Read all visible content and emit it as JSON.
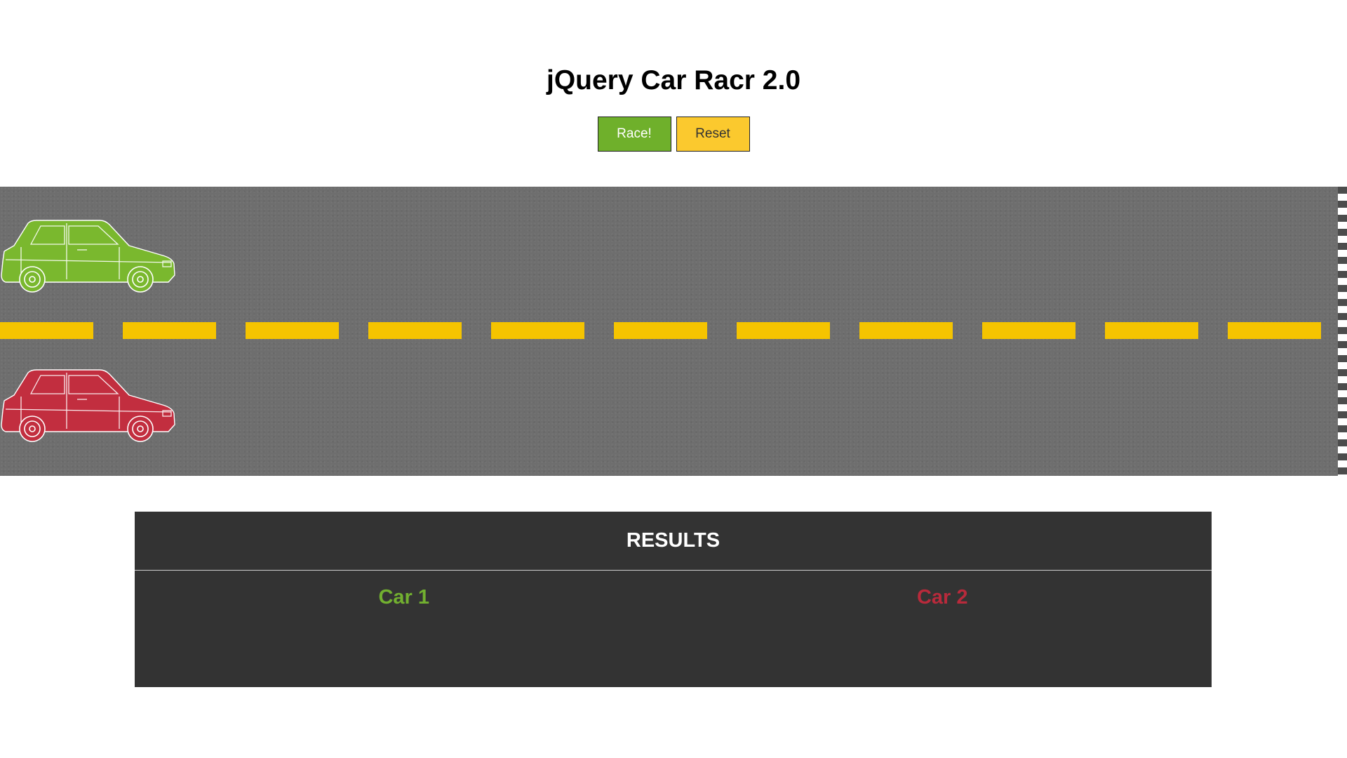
{
  "page": {
    "title": "jQuery Car Racr 2.0"
  },
  "controls": {
    "race_label": "Race!",
    "reset_label": "Reset"
  },
  "track": {
    "cars": [
      {
        "name": "car-1",
        "color": "#7ab82e",
        "progress": 0
      },
      {
        "name": "car-2",
        "color": "#c22e3f",
        "progress": 0
      }
    ]
  },
  "results": {
    "heading": "RESULTS",
    "columns": [
      {
        "label": "Car 1",
        "color": "#72b030"
      },
      {
        "label": "Car 2",
        "color": "#b82a3b"
      }
    ]
  },
  "colors": {
    "race_button": "#6fb02b",
    "reset_button": "#fbc92e",
    "lane_stripe": "#f5c400",
    "road": "#6e6e6e",
    "results_panel": "#333333"
  }
}
